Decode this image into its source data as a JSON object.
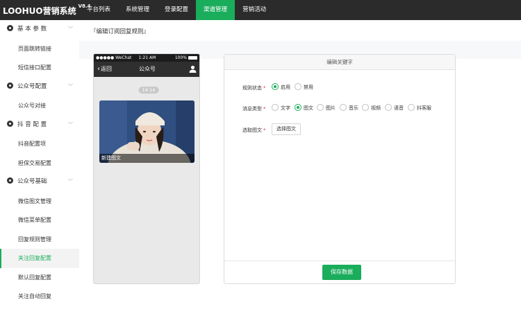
{
  "header": {
    "brand": "LOOHUO营销系统",
    "version": "V8.4",
    "nav": [
      {
        "label": "平台列表",
        "active": false
      },
      {
        "label": "系统管理",
        "active": false
      },
      {
        "label": "登录配置",
        "active": false
      },
      {
        "label": "渠道管理",
        "active": true
      },
      {
        "label": "营销活动",
        "active": false
      }
    ]
  },
  "sidebar": {
    "groups": [
      {
        "label": "基 本 参 数",
        "icon": "compass-icon",
        "items": [
          "页面跳转链接",
          "短信接口配置"
        ]
      },
      {
        "label": "公众号配置",
        "icon": "spinner-icon",
        "items": [
          "公众号对接"
        ]
      },
      {
        "label": "抖 音 配 置",
        "icon": "play-icon",
        "items": [
          "抖音配置项",
          "担保交易配置"
        ]
      },
      {
        "label": "公众号基础",
        "icon": "map-pin-icon",
        "items": [
          "微信图文管理",
          "微信菜单配置",
          "回复规则管理",
          "关注回复配置",
          "默认回复配置",
          "关注自动回复"
        ]
      }
    ],
    "active_item": "关注回复配置"
  },
  "breadcrumb": "『编辑订阅回复规则』",
  "phone": {
    "carrier": "●●●●● WeChat",
    "time": "1:21 AM",
    "battery": "100%",
    "back_label": "返回",
    "title": "公众号",
    "timestamp": "14:14",
    "card_title": "新建图文"
  },
  "editor": {
    "title": "编辑关键字",
    "status_label": "规则状态",
    "status_options": [
      "启用",
      "禁用"
    ],
    "status_selected": "启用",
    "type_label": "消息类型",
    "type_options": [
      "文字",
      "图文",
      "图片",
      "音乐",
      "视频",
      "语音",
      "抖客服"
    ],
    "type_selected": "图文",
    "pick_label": "选取图文",
    "pick_button": "选择图文",
    "save_button": "保存数据"
  },
  "colors": {
    "accent": "#1aad5b",
    "topbar": "#2b2b2b",
    "required": "#e0313b"
  }
}
